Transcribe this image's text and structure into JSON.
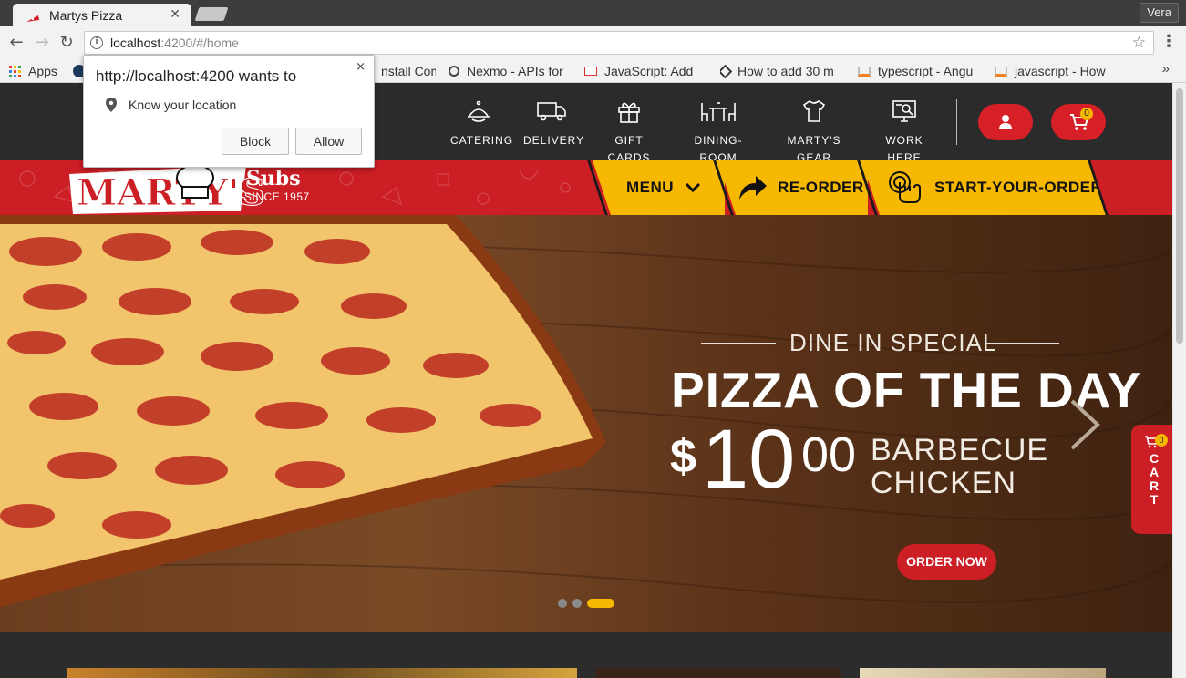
{
  "browser": {
    "tab_title": "Martys Pizza",
    "profile_name": "Vera",
    "url_host": "localhost",
    "url_path": ":4200/#/home",
    "bookmarks": [
      {
        "label": "Apps",
        "icon": "apps-grid-icon"
      },
      {
        "label": "",
        "icon": "account-icon"
      },
      {
        "label": "nstall Com",
        "icon": "page-icon"
      },
      {
        "label": "Nexmo - APIs for",
        "icon": "nexmo-icon"
      },
      {
        "label": "JavaScript: Add",
        "icon": "js-icon"
      },
      {
        "label": "How to add 30 m",
        "icon": "codepen-icon"
      },
      {
        "label": "typescript - Angu",
        "icon": "stackoverflow-icon"
      },
      {
        "label": "javascript - How",
        "icon": "stackoverflow-icon"
      }
    ],
    "more_bookmarks": "»"
  },
  "permission_popup": {
    "title": "http://localhost:4200 wants to",
    "permission": "Know your location",
    "block_label": "Block",
    "allow_label": "Allow",
    "close_label": "×"
  },
  "site": {
    "nav": [
      {
        "label": "CATERING",
        "icon": "catering-icon"
      },
      {
        "label": "DELIVERY",
        "icon": "delivery-truck-icon"
      },
      {
        "label": "GIFT CARDS",
        "icon": "gift-icon"
      },
      {
        "label": "DINING-ROOM",
        "icon": "dining-table-icon"
      },
      {
        "label": "MARTY'S GEAR",
        "icon": "tshirt-icon"
      },
      {
        "label": "WORK HERE",
        "icon": "jobs-icon"
      }
    ],
    "cart_count": "0",
    "logo_text": "MARTY'S",
    "logo_subs": "Subs",
    "logo_since": "SINCE 1957",
    "menu_label": "MENU",
    "reorder_label": "RE-ORDER",
    "start_order_label": "START-YOUR-ORDER",
    "hero": {
      "kicker": "DINE IN SPECIAL",
      "headline": "PIZZA OF THE DAY",
      "price_symbol": "$",
      "price_whole": "10",
      "price_cents": "00",
      "item_line1": "BARBECUE",
      "item_line2": "CHICKEN",
      "cta": "ORDER NOW",
      "active_slide": 3,
      "slide_count": 3
    },
    "side_cart": {
      "count": "0",
      "letters": [
        "C",
        "A",
        "R",
        "T"
      ]
    }
  },
  "colors": {
    "brand_red": "#cc1e25",
    "brand_yellow": "#f6b800",
    "nav_dark": "#2b2b2b"
  }
}
